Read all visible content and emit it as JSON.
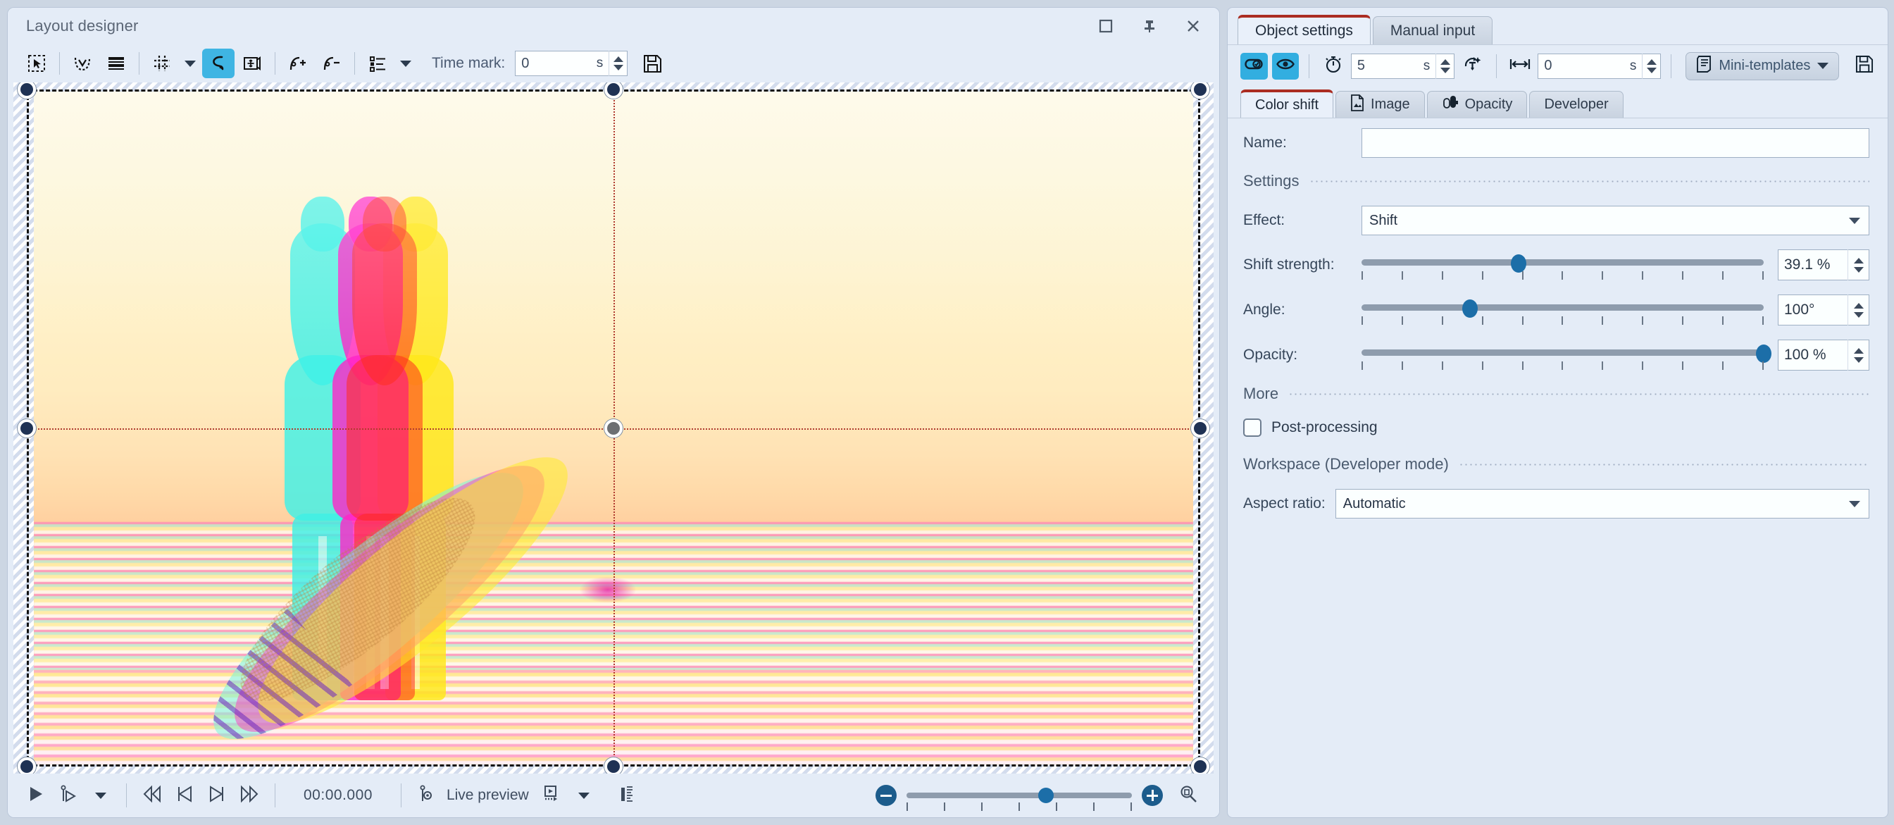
{
  "window": {
    "title": "Layout designer",
    "buttons": {
      "maximize": "maximize-icon",
      "pin": "pin-icon",
      "close": "close-icon"
    }
  },
  "toolbar": {
    "tools": [
      {
        "name": "select-region-tool",
        "label": "Select region"
      },
      {
        "name": "curve-tool",
        "label": "Curve"
      },
      {
        "name": "layers-tool",
        "label": "Layers"
      },
      {
        "name": "grid-tool",
        "label": "Grid"
      },
      {
        "name": "spline-tool",
        "label": "Spline",
        "active": true
      },
      {
        "name": "move-frame-tool",
        "label": "Move frame"
      },
      {
        "name": "add-keyframe-tool",
        "label": "Add key"
      },
      {
        "name": "remove-keyframe-tool",
        "label": "Remove key"
      },
      {
        "name": "list-tool",
        "label": "List"
      }
    ],
    "time_mark_label": "Time mark:",
    "time_mark_value": "0",
    "time_mark_unit": "s",
    "save_label": "Save"
  },
  "canvas": {
    "image_alt": "Surfers on the beach with RGB color-shift effect",
    "guides": "center crosshair guides",
    "handles": 9
  },
  "transport": {
    "play": "play-icon",
    "play_from_marker": "play-from-marker-icon",
    "play_menu": "chevron-down-icon",
    "rewind": "rewind-icon",
    "prev_frame": "previous-frame-icon",
    "next_frame": "next-frame-icon",
    "fast_forward": "fast-forward-icon",
    "timecode": "00:00.000",
    "live_preview_label": "Live preview",
    "live_preview_icon": "live-preview-icon",
    "preview_mode_icon": "preview-mode-icon",
    "preview_menu": "chevron-down-icon",
    "stats_icon": "statistics-icon",
    "zoom_out": "zoom-out-icon",
    "zoom_in": "zoom-in-icon",
    "zoom_fit": "zoom-fit-icon",
    "zoom_percent": 62
  },
  "panel": {
    "tabs": [
      {
        "label": "Object settings",
        "active": true
      },
      {
        "label": "Manual input",
        "active": false
      }
    ],
    "toolbar": {
      "link_toggle": "link-icon",
      "visibility_toggle": "eye-icon",
      "duration_icon": "stopwatch-icon",
      "duration_value": "5",
      "duration_unit": "s",
      "animate_icon": "animate-icon",
      "offset_icon": "offset-icon",
      "offset_value": "0",
      "offset_unit": "s",
      "mini_templates_label": "Mini-templates",
      "mini_templates_icon": "template-icon",
      "save_icon": "save-icon"
    },
    "subtabs": [
      {
        "label": "Color shift",
        "icon": null,
        "active": true
      },
      {
        "label": "Image",
        "icon": "image-file-icon",
        "active": false
      },
      {
        "label": "Opacity",
        "icon": "opacity-icon",
        "active": false
      },
      {
        "label": "Developer",
        "icon": null,
        "active": false
      }
    ],
    "name_label": "Name:",
    "name_value": "",
    "settings_section": "Settings",
    "effect_label": "Effect:",
    "effect_value": "Shift",
    "shift_strength_label": "Shift strength:",
    "shift_strength_value": "39.1 %",
    "shift_strength_percent": 39.1,
    "angle_label": "Angle:",
    "angle_value": "100°",
    "angle_percent": 27,
    "opacity_label": "Opacity:",
    "opacity_value": "100 %",
    "opacity_percent": 100,
    "more_section": "More",
    "postprocessing_label": "Post-processing",
    "postprocessing_checked": false,
    "workspace_section": "Workspace (Developer mode)",
    "aspect_ratio_label": "Aspect ratio:",
    "aspect_ratio_value": "Automatic"
  },
  "colors": {
    "accent": "#32aee0",
    "active_tab_underline": "#ab2d22",
    "slider": "#1c6ea8",
    "panel_bg": "#e4ecf7",
    "handle": "#1f3254"
  }
}
